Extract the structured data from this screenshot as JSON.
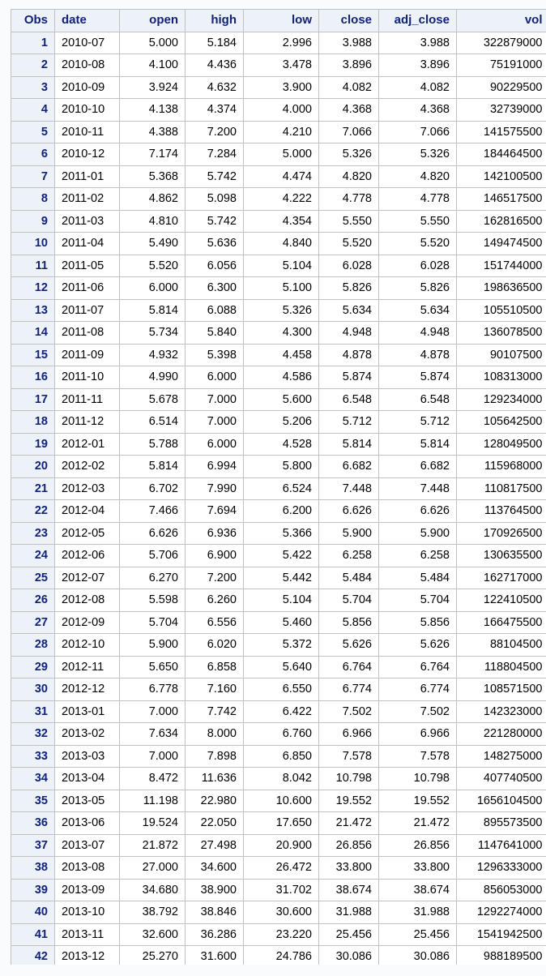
{
  "table": {
    "columns": [
      {
        "key": "obs",
        "label": "Obs",
        "align": "num"
      },
      {
        "key": "date",
        "label": "date",
        "align": "txt"
      },
      {
        "key": "open",
        "label": "open",
        "align": "num"
      },
      {
        "key": "high",
        "label": "high",
        "align": "num"
      },
      {
        "key": "low",
        "label": "low",
        "align": "num"
      },
      {
        "key": "close",
        "label": "close",
        "align": "num"
      },
      {
        "key": "adj_close",
        "label": "adj_close",
        "align": "num"
      },
      {
        "key": "vol",
        "label": "vol",
        "align": "num"
      }
    ],
    "rows": [
      [
        "1",
        "2010-07",
        "5.000",
        "5.184",
        "2.996",
        "3.988",
        "3.988",
        "322879000"
      ],
      [
        "2",
        "2010-08",
        "4.100",
        "4.436",
        "3.478",
        "3.896",
        "3.896",
        "75191000"
      ],
      [
        "3",
        "2010-09",
        "3.924",
        "4.632",
        "3.900",
        "4.082",
        "4.082",
        "90229500"
      ],
      [
        "4",
        "2010-10",
        "4.138",
        "4.374",
        "4.000",
        "4.368",
        "4.368",
        "32739000"
      ],
      [
        "5",
        "2010-11",
        "4.388",
        "7.200",
        "4.210",
        "7.066",
        "7.066",
        "141575500"
      ],
      [
        "6",
        "2010-12",
        "7.174",
        "7.284",
        "5.000",
        "5.326",
        "5.326",
        "184464500"
      ],
      [
        "7",
        "2011-01",
        "5.368",
        "5.742",
        "4.474",
        "4.820",
        "4.820",
        "142100500"
      ],
      [
        "8",
        "2011-02",
        "4.862",
        "5.098",
        "4.222",
        "4.778",
        "4.778",
        "146517500"
      ],
      [
        "9",
        "2011-03",
        "4.810",
        "5.742",
        "4.354",
        "5.550",
        "5.550",
        "162816500"
      ],
      [
        "10",
        "2011-04",
        "5.490",
        "5.636",
        "4.840",
        "5.520",
        "5.520",
        "149474500"
      ],
      [
        "11",
        "2011-05",
        "5.520",
        "6.056",
        "5.104",
        "6.028",
        "6.028",
        "151744000"
      ],
      [
        "12",
        "2011-06",
        "6.000",
        "6.300",
        "5.100",
        "5.826",
        "5.826",
        "198636500"
      ],
      [
        "13",
        "2011-07",
        "5.814",
        "6.088",
        "5.326",
        "5.634",
        "5.634",
        "105510500"
      ],
      [
        "14",
        "2011-08",
        "5.734",
        "5.840",
        "4.300",
        "4.948",
        "4.948",
        "136078500"
      ],
      [
        "15",
        "2011-09",
        "4.932",
        "5.398",
        "4.458",
        "4.878",
        "4.878",
        "90107500"
      ],
      [
        "16",
        "2011-10",
        "4.990",
        "6.000",
        "4.586",
        "5.874",
        "5.874",
        "108313000"
      ],
      [
        "17",
        "2011-11",
        "5.678",
        "7.000",
        "5.600",
        "6.548",
        "6.548",
        "129234000"
      ],
      [
        "18",
        "2011-12",
        "6.514",
        "7.000",
        "5.206",
        "5.712",
        "5.712",
        "105642500"
      ],
      [
        "19",
        "2012-01",
        "5.788",
        "6.000",
        "4.528",
        "5.814",
        "5.814",
        "128049500"
      ],
      [
        "20",
        "2012-02",
        "5.814",
        "6.994",
        "5.800",
        "6.682",
        "6.682",
        "115968000"
      ],
      [
        "21",
        "2012-03",
        "6.702",
        "7.990",
        "6.524",
        "7.448",
        "7.448",
        "110817500"
      ],
      [
        "22",
        "2012-04",
        "7.466",
        "7.694",
        "6.200",
        "6.626",
        "6.626",
        "113764500"
      ],
      [
        "23",
        "2012-05",
        "6.626",
        "6.936",
        "5.366",
        "5.900",
        "5.900",
        "170926500"
      ],
      [
        "24",
        "2012-06",
        "5.706",
        "6.900",
        "5.422",
        "6.258",
        "6.258",
        "130635500"
      ],
      [
        "25",
        "2012-07",
        "6.270",
        "7.200",
        "5.442",
        "5.484",
        "5.484",
        "162717000"
      ],
      [
        "26",
        "2012-08",
        "5.598",
        "6.260",
        "5.104",
        "5.704",
        "5.704",
        "122410500"
      ],
      [
        "27",
        "2012-09",
        "5.704",
        "6.556",
        "5.460",
        "5.856",
        "5.856",
        "166475500"
      ],
      [
        "28",
        "2012-10",
        "5.900",
        "6.020",
        "5.372",
        "5.626",
        "5.626",
        "88104500"
      ],
      [
        "29",
        "2012-11",
        "5.650",
        "6.858",
        "5.640",
        "6.764",
        "6.764",
        "118804500"
      ],
      [
        "30",
        "2012-12",
        "6.778",
        "7.160",
        "6.550",
        "6.774",
        "6.774",
        "108571500"
      ],
      [
        "31",
        "2013-01",
        "7.000",
        "7.742",
        "6.422",
        "7.502",
        "7.502",
        "142323000"
      ],
      [
        "32",
        "2013-02",
        "7.634",
        "8.000",
        "6.760",
        "6.966",
        "6.966",
        "221280000"
      ],
      [
        "33",
        "2013-03",
        "7.000",
        "7.898",
        "6.850",
        "7.578",
        "7.578",
        "148275000"
      ],
      [
        "34",
        "2013-04",
        "8.472",
        "11.636",
        "8.042",
        "10.798",
        "10.798",
        "407740500"
      ],
      [
        "35",
        "2013-05",
        "11.198",
        "22.980",
        "10.600",
        "19.552",
        "19.552",
        "1656104500"
      ],
      [
        "36",
        "2013-06",
        "19.524",
        "22.050",
        "17.650",
        "21.472",
        "21.472",
        "895573500"
      ],
      [
        "37",
        "2013-07",
        "21.872",
        "27.498",
        "20.900",
        "26.856",
        "26.856",
        "1147641000"
      ],
      [
        "38",
        "2013-08",
        "27.000",
        "34.600",
        "26.472",
        "33.800",
        "33.800",
        "1296333000"
      ],
      [
        "39",
        "2013-09",
        "34.680",
        "38.900",
        "31.702",
        "38.674",
        "38.674",
        "856053000"
      ],
      [
        "40",
        "2013-10",
        "38.792",
        "38.846",
        "30.600",
        "31.988",
        "31.988",
        "1292274000"
      ],
      [
        "41",
        "2013-11",
        "32.600",
        "36.286",
        "23.220",
        "25.456",
        "25.456",
        "1541942500"
      ],
      [
        "42",
        "2013-12",
        "25.270",
        "31.600",
        "24.786",
        "30.086",
        "30.086",
        "988189500"
      ]
    ]
  }
}
